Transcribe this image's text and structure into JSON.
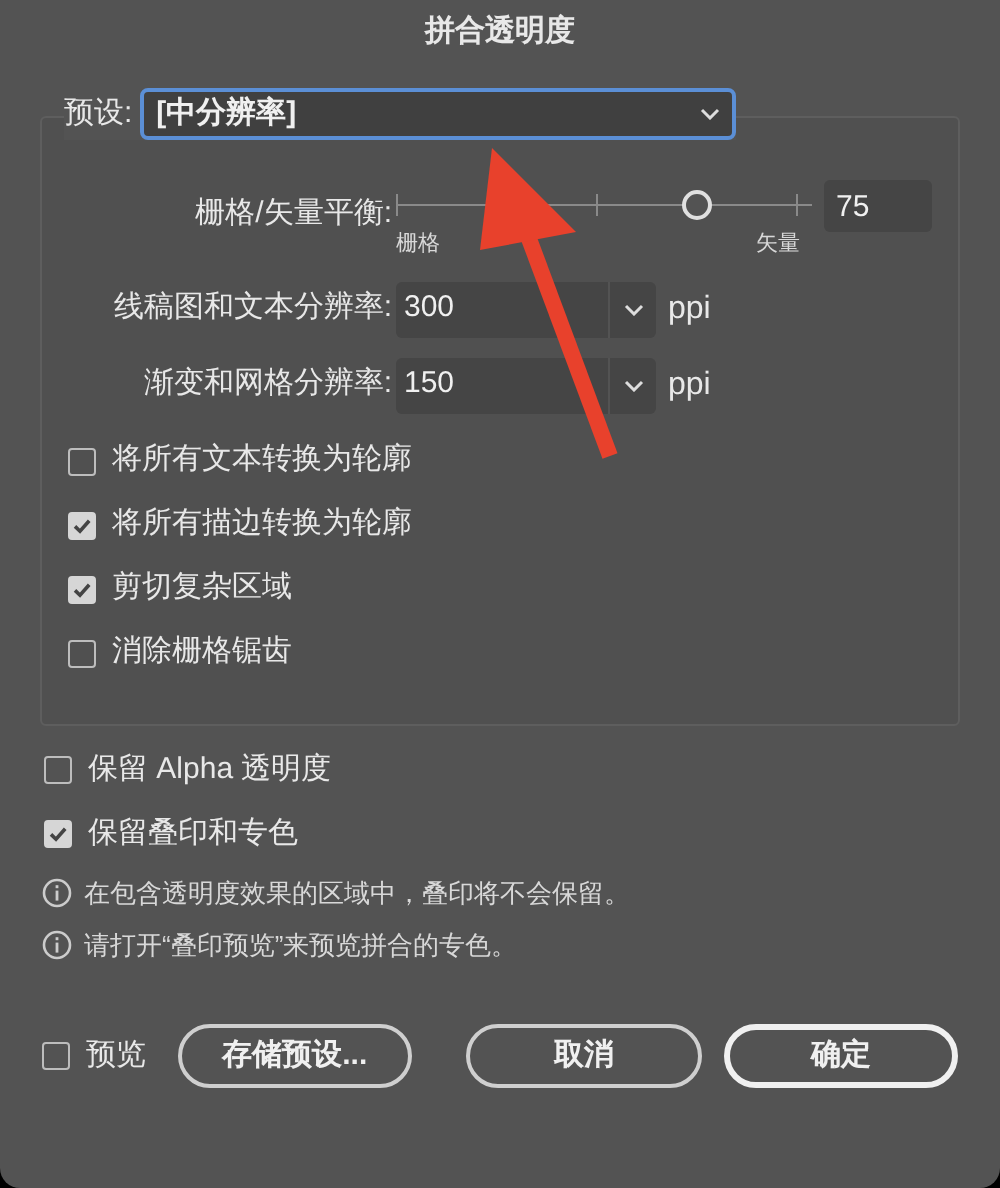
{
  "window": {
    "title": "拼合透明度"
  },
  "preset": {
    "label": "预设:",
    "value": "[中分辨率]"
  },
  "balance": {
    "label": "栅格/矢量平衡:",
    "level": 0.75,
    "value": "75",
    "min_label": "栅格",
    "max_label": "矢量"
  },
  "resolutions": [
    {
      "label": "线稿图和文本分辨率:",
      "value": "300",
      "unit": "ppi"
    },
    {
      "label": "渐变和网格分辨率:",
      "value": "150",
      "unit": "ppi"
    }
  ],
  "group_options": [
    {
      "label": "将所有文本转换为轮廓",
      "checked": false
    },
    {
      "label": "将所有描边转换为轮廓",
      "checked": true
    },
    {
      "label": "剪切复杂区域",
      "checked": true
    },
    {
      "label": "消除栅格锯齿",
      "checked": false
    }
  ],
  "options": [
    {
      "label": "保留 Alpha 透明度",
      "checked": false
    },
    {
      "label": "保留叠印和专色",
      "checked": true
    }
  ],
  "notes": [
    "在包含透明度效果的区域中，叠印将不会保留。",
    "请打开“叠印预览”来预览拼合的专色。"
  ],
  "preview": {
    "label": "预览",
    "checked": false
  },
  "buttons": [
    {
      "label": "存储预设...",
      "default": false
    },
    {
      "label": "取消",
      "default": false
    },
    {
      "label": "确定",
      "default": true
    }
  ],
  "annotation": {
    "kind": "arrow"
  }
}
